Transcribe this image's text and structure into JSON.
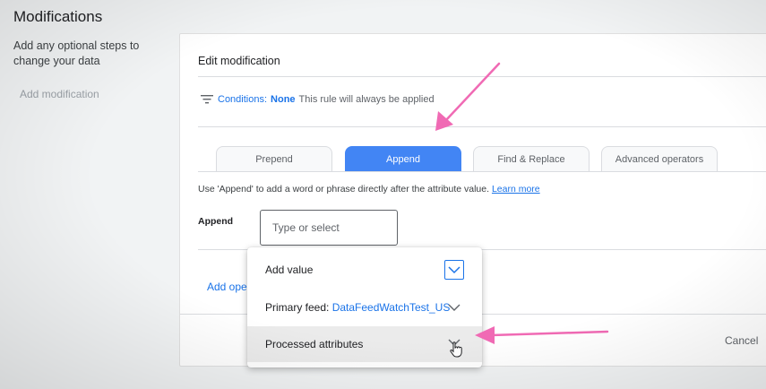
{
  "page": {
    "title": "Modifications",
    "description": "Add any optional steps to change your data",
    "add_modification_link": "Add modification"
  },
  "editor": {
    "title": "Edit modification",
    "conditions_label": "Conditions:",
    "conditions_value": "None",
    "conditions_note": "This rule will always be applied",
    "tabs": [
      {
        "label": "Prepend",
        "active": false
      },
      {
        "label": "Append",
        "active": true
      },
      {
        "label": "Find & Replace",
        "active": false
      },
      {
        "label": "Advanced operators",
        "active": false
      }
    ],
    "helper_text": "Use 'Append' to add a word or phrase directly after the attribute value.",
    "learn_more": "Learn more",
    "field_label": "Append",
    "input_placeholder": "Type or select",
    "add_operation_link": "Add ope",
    "cancel_label": "Cancel"
  },
  "dropdown": {
    "items": [
      {
        "label": "Add value",
        "icon": "chevron-down-icon"
      },
      {
        "label": "Primary feed:",
        "feed": "DataFeedWatchTest_US",
        "icon": "chevron-down-icon"
      },
      {
        "label": "Processed attributes",
        "icon": "chevron-down-icon",
        "hovered": true
      }
    ]
  },
  "colors": {
    "accent": "#4285f4",
    "link": "#1a73e8",
    "annotation_arrow": "#f06ab4"
  }
}
